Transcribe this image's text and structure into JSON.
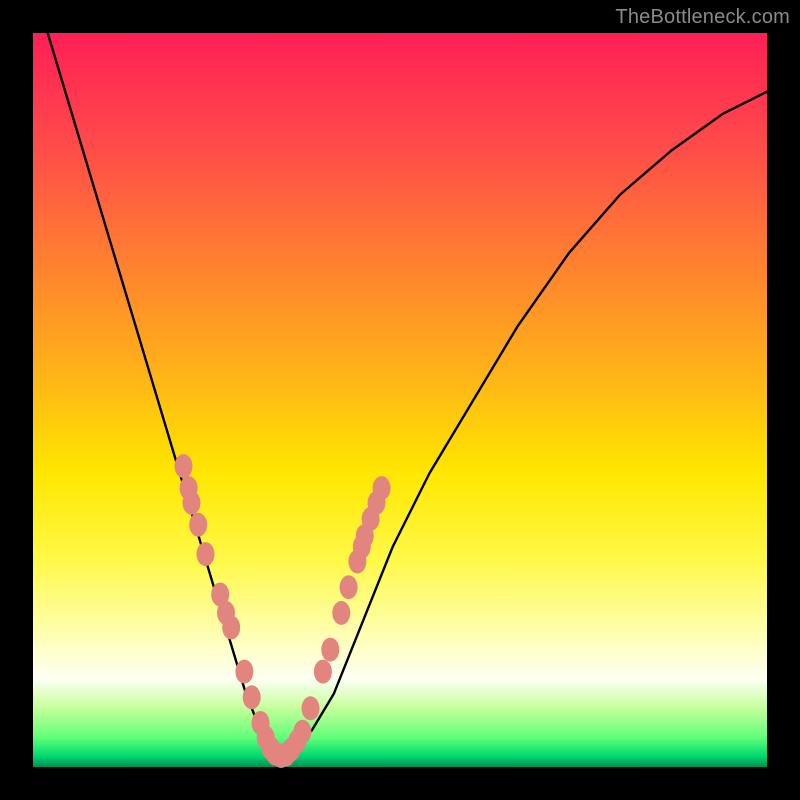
{
  "watermark": "TheBottleneck.com",
  "chart_data": {
    "type": "line",
    "title": "",
    "xlabel": "",
    "ylabel": "",
    "xlim": [
      0,
      1
    ],
    "ylim": [
      0,
      1
    ],
    "series": [
      {
        "name": "bottleneck-curve",
        "x": [
          0.0,
          0.02,
          0.05,
          0.08,
          0.11,
          0.14,
          0.17,
          0.2,
          0.23,
          0.26,
          0.29,
          0.31,
          0.33,
          0.35,
          0.38,
          0.41,
          0.45,
          0.49,
          0.54,
          0.6,
          0.66,
          0.73,
          0.8,
          0.87,
          0.94,
          1.0
        ],
        "y": [
          1.1,
          1.0,
          0.9,
          0.8,
          0.7,
          0.6,
          0.5,
          0.4,
          0.3,
          0.2,
          0.1,
          0.05,
          0.02,
          0.02,
          0.05,
          0.1,
          0.2,
          0.3,
          0.4,
          0.5,
          0.6,
          0.7,
          0.78,
          0.84,
          0.89,
          0.92
        ]
      }
    ],
    "markers": [
      {
        "x": 0.205,
        "y": 0.41
      },
      {
        "x": 0.212,
        "y": 0.38
      },
      {
        "x": 0.216,
        "y": 0.36
      },
      {
        "x": 0.225,
        "y": 0.33
      },
      {
        "x": 0.235,
        "y": 0.29
      },
      {
        "x": 0.255,
        "y": 0.235
      },
      {
        "x": 0.263,
        "y": 0.21
      },
      {
        "x": 0.27,
        "y": 0.19
      },
      {
        "x": 0.288,
        "y": 0.13
      },
      {
        "x": 0.298,
        "y": 0.095
      },
      {
        "x": 0.31,
        "y": 0.06
      },
      {
        "x": 0.317,
        "y": 0.04
      },
      {
        "x": 0.324,
        "y": 0.025
      },
      {
        "x": 0.33,
        "y": 0.018
      },
      {
        "x": 0.338,
        "y": 0.015
      },
      {
        "x": 0.345,
        "y": 0.017
      },
      {
        "x": 0.352,
        "y": 0.024
      },
      {
        "x": 0.36,
        "y": 0.035
      },
      {
        "x": 0.367,
        "y": 0.048
      },
      {
        "x": 0.378,
        "y": 0.08
      },
      {
        "x": 0.395,
        "y": 0.13
      },
      {
        "x": 0.405,
        "y": 0.16
      },
      {
        "x": 0.42,
        "y": 0.21
      },
      {
        "x": 0.43,
        "y": 0.245
      },
      {
        "x": 0.442,
        "y": 0.28
      },
      {
        "x": 0.448,
        "y": 0.3
      },
      {
        "x": 0.452,
        "y": 0.315
      },
      {
        "x": 0.46,
        "y": 0.338
      },
      {
        "x": 0.468,
        "y": 0.36
      },
      {
        "x": 0.475,
        "y": 0.38
      }
    ],
    "marker_color": "#e2857f",
    "curve_color": "#000000"
  }
}
